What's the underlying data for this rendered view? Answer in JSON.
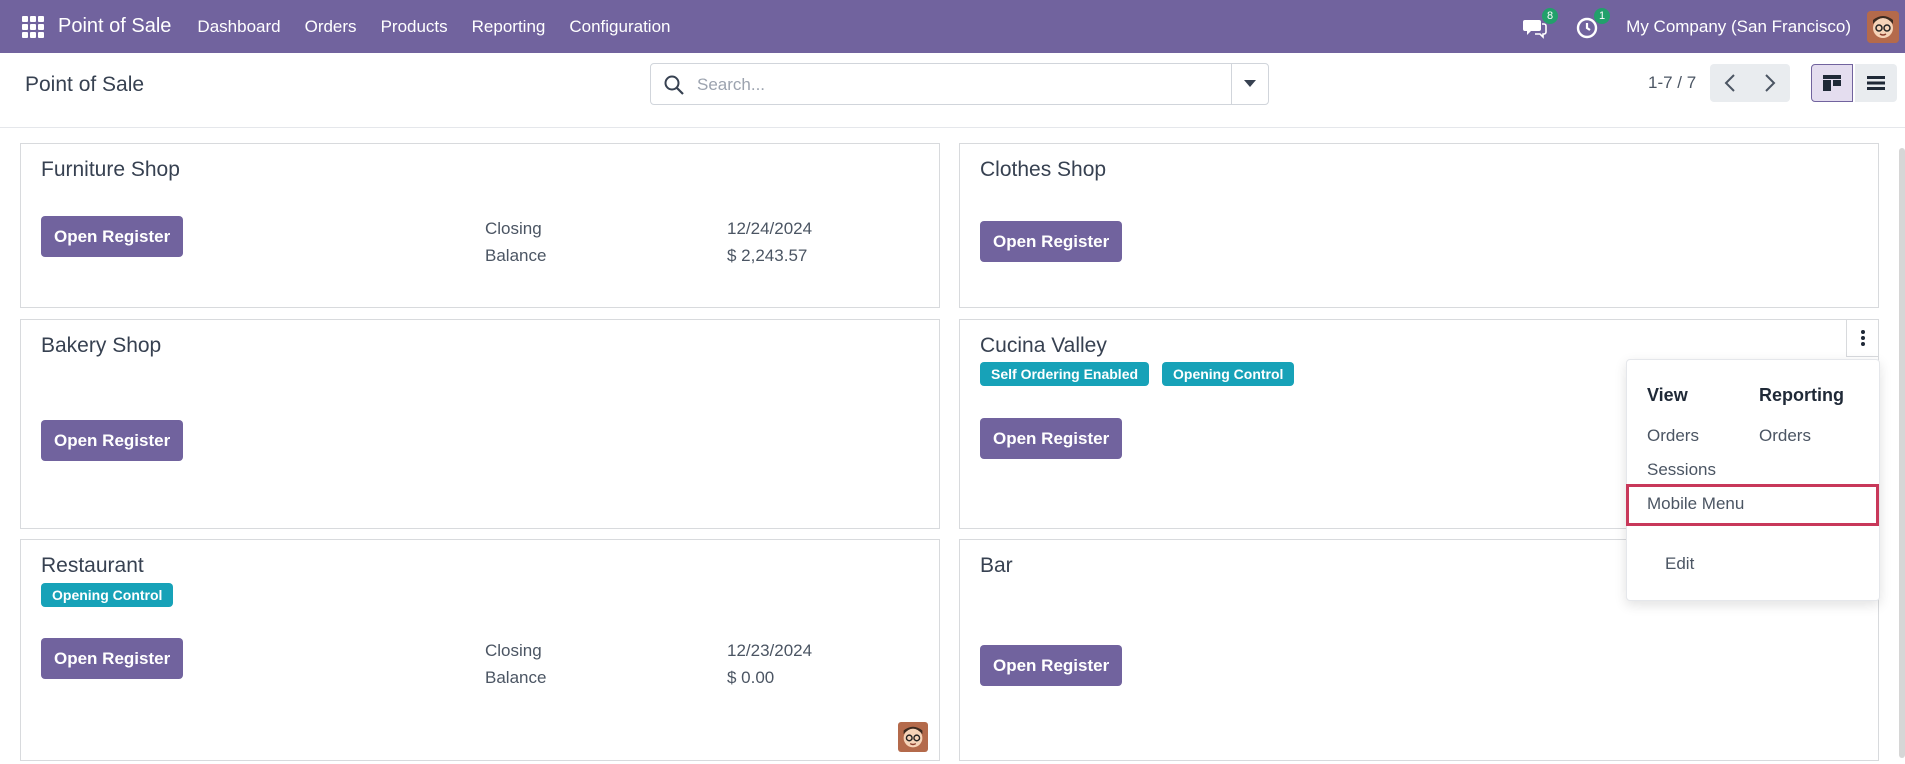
{
  "navbar": {
    "brand": "Point of Sale",
    "menu": [
      "Dashboard",
      "Orders",
      "Products",
      "Reporting",
      "Configuration"
    ],
    "messages_count": "8",
    "activities_count": "1",
    "company": "My Company (San Francisco)"
  },
  "control": {
    "title": "Point of Sale",
    "search_placeholder": "Search...",
    "pager": "1-7 / 7"
  },
  "cards": {
    "furniture": {
      "title": "Furniture Shop",
      "button": "Open Register",
      "closing_label": "Closing",
      "closing_value": "12/24/2024",
      "balance_label": "Balance",
      "balance_value": "$ 2,243.57"
    },
    "clothes": {
      "title": "Clothes Shop",
      "button": "Open Register"
    },
    "bakery": {
      "title": "Bakery Shop",
      "button": "Open Register"
    },
    "cucina": {
      "title": "Cucina Valley",
      "tags": [
        "Self Ordering Enabled",
        "Opening Control"
      ],
      "button": "Open Register"
    },
    "restaurant": {
      "title": "Restaurant",
      "tags": [
        "Opening Control"
      ],
      "button": "Open Register",
      "closing_label": "Closing",
      "closing_value": "12/23/2024",
      "balance_label": "Balance",
      "balance_value": "$ 0.00"
    },
    "bar": {
      "title": "Bar",
      "button": "Open Register"
    }
  },
  "dropdown": {
    "view_header": "View",
    "reporting_header": "Reporting",
    "view_items": [
      "Orders",
      "Sessions",
      "Mobile Menu"
    ],
    "reporting_items": [
      "Orders"
    ],
    "edit": "Edit"
  },
  "colors": {
    "brand": "#71639e",
    "tag": "#17a2b8",
    "highlight": "#c8385a"
  }
}
